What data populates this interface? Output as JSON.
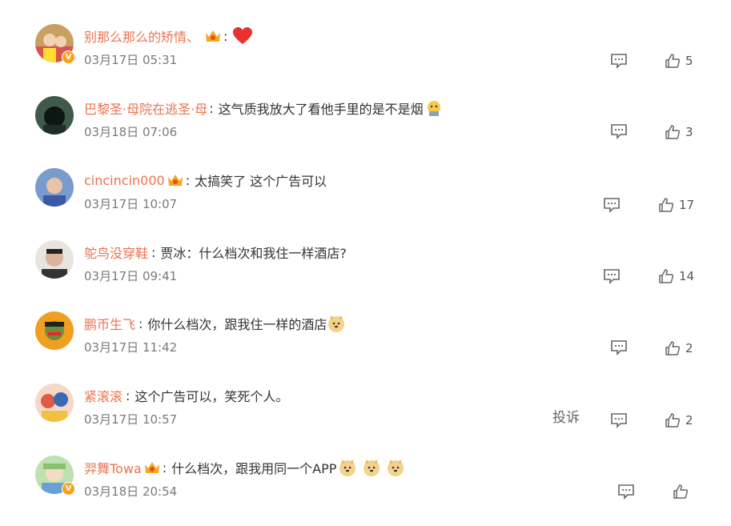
{
  "comments": [
    {
      "username": "别那么那么的矫情、",
      "separator": ":",
      "text": "",
      "time": "03月17日 05:31",
      "likes": "5",
      "avatar_color": "#d9534f"
    },
    {
      "username": "巴黎圣·母院在逃圣·母",
      "separator": ":",
      "text": "这气质我放大了看他手里的是不是烟",
      "time": "03月18日 07:06",
      "likes": "3",
      "avatar_color": "#3f5a4a"
    },
    {
      "username": "cincincin000",
      "separator": ":",
      "text": "太搞笑了 这个广告可以",
      "time": "03月17日 10:07",
      "likes": "17",
      "avatar_color": "#4a78c2"
    },
    {
      "username": "鸵鸟没穿鞋",
      "separator": ":",
      "text": "贾冰：什么档次和我住一样酒店?",
      "time": "03月17日 09:41",
      "likes": "14",
      "avatar_color": "#cfc8c2"
    },
    {
      "username": "鹏币生飞",
      "separator": ":",
      "text": "你什么档次，跟我住一样的酒店",
      "time": "03月17日 11:42",
      "likes": "2",
      "avatar_color": "#f0a020"
    },
    {
      "username": "紧滚滚",
      "separator": ":",
      "text": "这个广告可以，笑死个人。",
      "time": "03月17日 10:57",
      "likes": "2",
      "avatar_color": "#e05a4a",
      "report": "投诉"
    },
    {
      "username": "羿舞Towa",
      "separator": ":",
      "text": "什么档次，跟我用同一个APP",
      "time": "03月18日 20:54",
      "likes": "",
      "avatar_color": "#8cc070"
    }
  ],
  "colors": {
    "username": "#eb7350",
    "text": "#333333",
    "time": "#7a7a7a",
    "icon": "#666666"
  }
}
